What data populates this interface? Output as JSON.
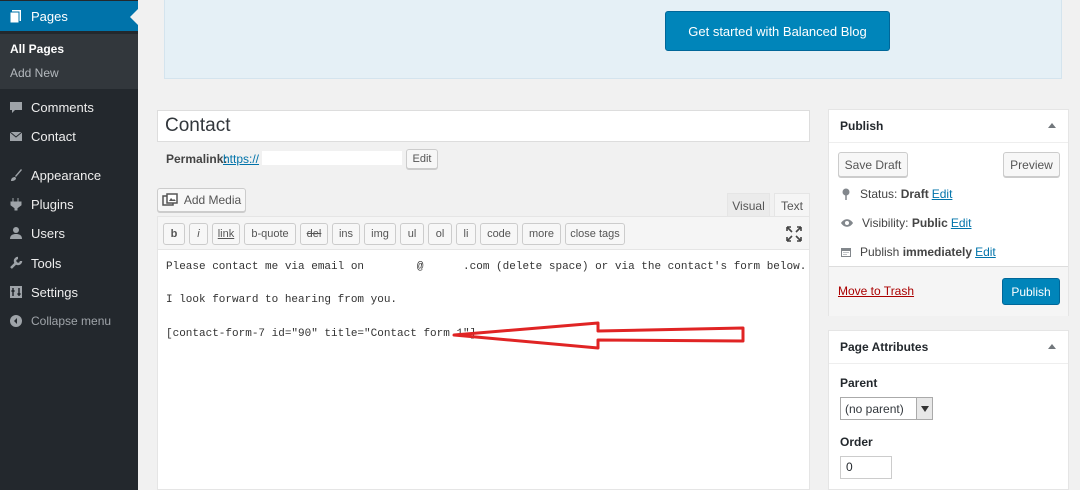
{
  "sidebar": {
    "pages": "Pages",
    "all_pages": "All Pages",
    "add_new": "Add New",
    "comments": "Comments",
    "contact": "Contact",
    "appearance": "Appearance",
    "plugins": "Plugins",
    "users": "Users",
    "tools": "Tools",
    "settings": "Settings",
    "collapse": "Collapse menu"
  },
  "notice": {
    "button": "Get started with Balanced Blog"
  },
  "editor": {
    "title": "Contact",
    "permalink_label": "Permalink:",
    "permalink_url": "https://",
    "edit_label": "Edit",
    "add_media": "Add Media",
    "tab_visual": "Visual",
    "tab_text": "Text",
    "quicktags": [
      "b",
      "i",
      "link",
      "b-quote",
      "del",
      "ins",
      "img",
      "ul",
      "ol",
      "li",
      "code",
      "more",
      "close tags"
    ],
    "content": {
      "line1": "Please contact me via email on        @      .com (delete space) or via the contact's form below.",
      "line2": "I look forward to hearing from you.",
      "line3": "[contact-form-7 id=\"90\" title=\"Contact form 1\"]"
    }
  },
  "publish": {
    "title": "Publish",
    "save_draft": "Save Draft",
    "preview": "Preview",
    "status_label": "Status:",
    "status_value": "Draft",
    "visibility_label": "Visibility:",
    "visibility_value": "Public",
    "publish_label": "Publish",
    "publish_value": "immediately",
    "edit": "Edit",
    "trash": "Move to Trash",
    "publish_button": "Publish"
  },
  "attributes": {
    "title": "Page Attributes",
    "parent_label": "Parent",
    "parent_value": "(no parent)",
    "order_label": "Order",
    "order_value": "0"
  },
  "colors": {
    "accent": "#0073aa",
    "button": "#0085ba",
    "arrow": "#e02424"
  }
}
